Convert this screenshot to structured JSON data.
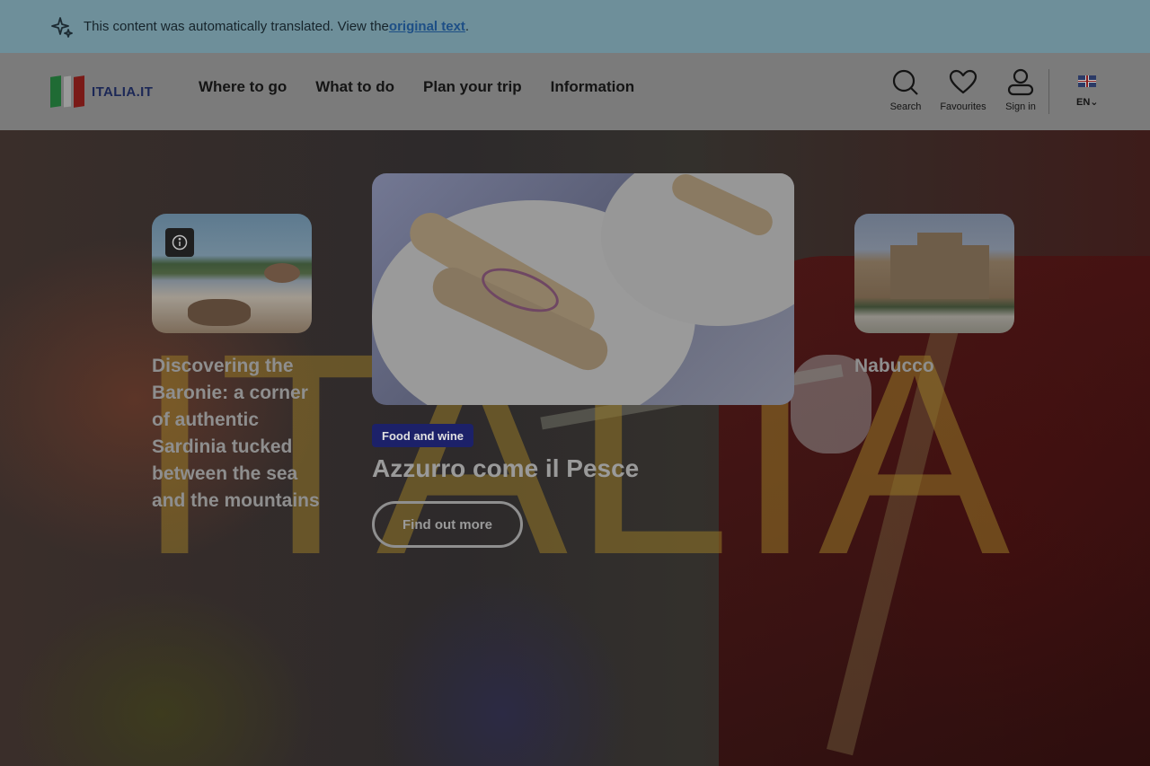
{
  "banner": {
    "message": "This content was automatically translated. View the ",
    "link_text": "original text",
    "suffix": "."
  },
  "header": {
    "logo_text": "ITALIA.IT",
    "nav": [
      "Where to go",
      "What to do",
      "Plan your trip",
      "Information"
    ],
    "tools": {
      "search": "Search",
      "favourites": "Favourites",
      "sign_in": "Sign in"
    },
    "language": "EN"
  },
  "hero": {
    "watermark": "ITALIA",
    "cards": {
      "left_title": "Discovering the Baronie: a corner of authentic Sardinia tucked between the sea and the mountains",
      "right_title": "Nabucco"
    },
    "featured": {
      "category": "Food and wine",
      "title": "Azzurro come il Pesce",
      "cta": "Find out more"
    }
  }
}
